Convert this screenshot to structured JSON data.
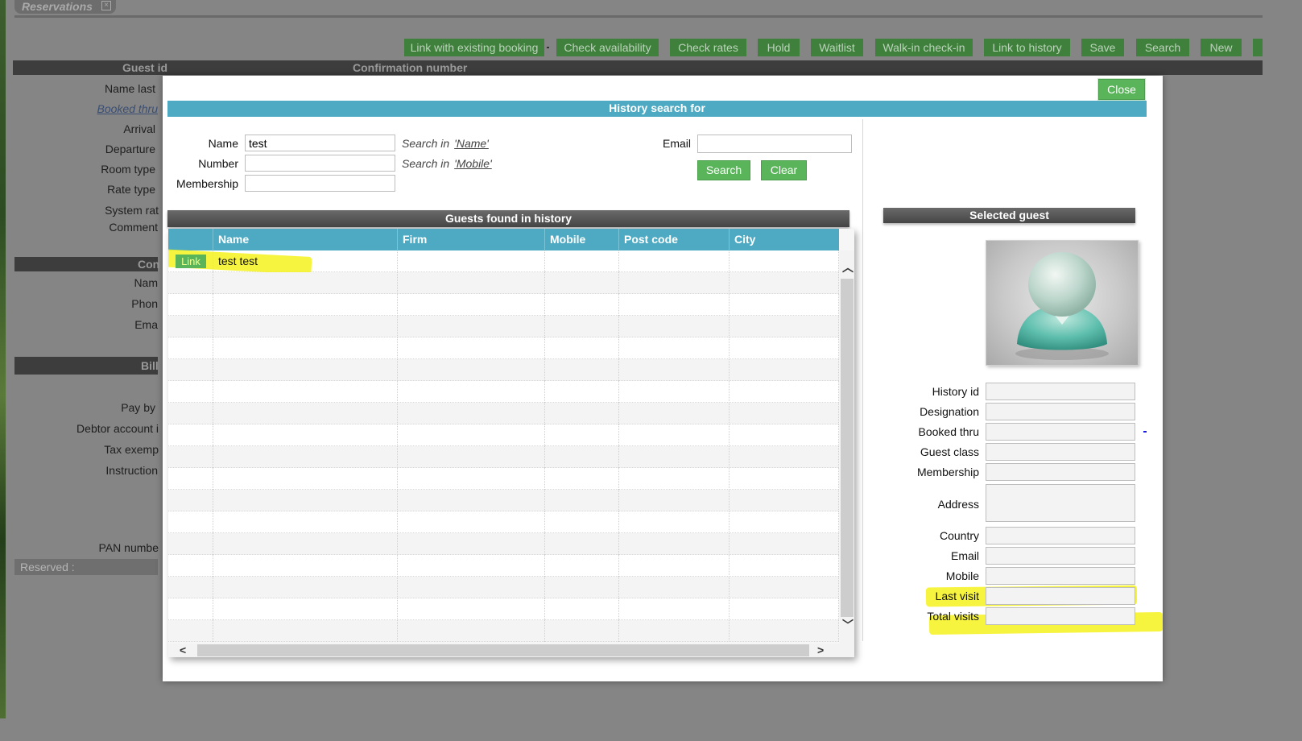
{
  "window": {
    "tab_title": "Reservations"
  },
  "toolbar": {
    "buttons": [
      "Link with existing booking",
      "Check availability",
      "Check rates",
      "Hold",
      "Waitlist",
      "Walk-in check-in",
      "Link to history",
      "Save",
      "Search",
      "New"
    ]
  },
  "background_form": {
    "guest_id_header": "Guest id",
    "confirmation_header": "Confirmation number",
    "labels": {
      "name_last": "Name last",
      "booked_thru": "Booked thru",
      "arrival": "Arrival",
      "departure": "Departure",
      "room_type": "Room type",
      "rate_type": "Rate type",
      "system_rate": "System rat",
      "comment": "Comment",
      "contact_section": "Con",
      "name": "Nam",
      "phone": "Phon",
      "email": "Ema",
      "billing_section": "Bill",
      "pay_by": "Pay by",
      "debtor_account": "Debtor account i",
      "tax_exempt": "Tax exemp",
      "instruction": "Instruction",
      "pan_number": "PAN numbe"
    },
    "reserved_label": "Reserved :"
  },
  "modal": {
    "close_label": "Close",
    "header": "History search for",
    "search": {
      "name_label": "Name",
      "name_value": "test",
      "number_label": "Number",
      "number_value": "",
      "membership_label": "Membership",
      "membership_value": "",
      "search_in_label": "Search in",
      "name_hint_link": "'Name'",
      "number_hint_link": "'Mobile'",
      "email_label": "Email",
      "email_value": "",
      "search_button": "Search",
      "clear_button": "Clear"
    },
    "results": {
      "title": "Guests found in history",
      "columns": [
        "",
        "Name",
        "Firm",
        "Mobile",
        "Post code",
        "City"
      ],
      "link_label": "Link",
      "rows": [
        {
          "name": "test test",
          "firm": "",
          "mobile": "",
          "post_code": "",
          "city": ""
        }
      ],
      "empty_rows": 17
    },
    "selected_guest": {
      "title": "Selected guest",
      "fields": [
        {
          "label": "History id",
          "value": ""
        },
        {
          "label": "Designation",
          "value": ""
        },
        {
          "label": "Booked thru",
          "value": ""
        },
        {
          "label": "Guest class",
          "value": ""
        },
        {
          "label": "Membership",
          "value": ""
        },
        {
          "label": "Address",
          "value": ""
        },
        {
          "label": "Country",
          "value": ""
        },
        {
          "label": "Email",
          "value": ""
        },
        {
          "label": "Mobile",
          "value": ""
        },
        {
          "label": "Last visit",
          "value": ""
        },
        {
          "label": "Total visits",
          "value": ""
        }
      ]
    }
  },
  "colors": {
    "accent_teal": "#4eaac3",
    "button_green": "#5ab55a",
    "highlight_yellow": "#f6f21e"
  }
}
